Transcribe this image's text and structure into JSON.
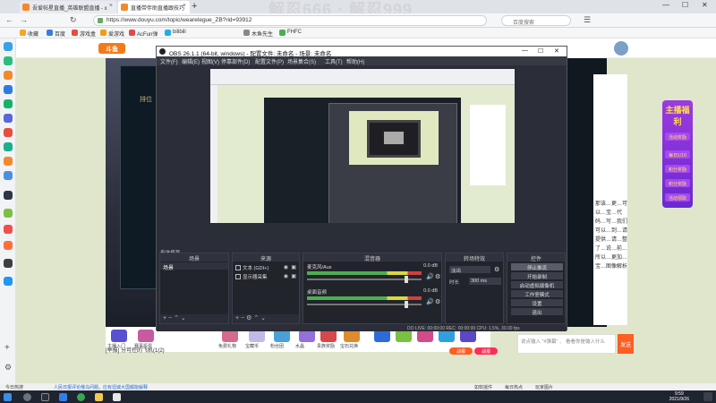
{
  "browser": {
    "tabs": [
      {
        "label": "吾爱帖星直播_英雄联盟直播 - x",
        "active": false
      },
      {
        "label": "直播带伴助直播跟技巧",
        "active": true
      }
    ],
    "watermark": "解忍666 · 解忍999",
    "url": "https://www.douyu.com/topic/wearelegue_ZB?rid=93912",
    "search_placeholder": "百度搜索",
    "bookmarks": [
      "收藏",
      "百度",
      "游戏盒",
      "爱游戏",
      "AcFun弹",
      "bilibili",
      "木鱼先生",
      "FHFC"
    ]
  },
  "page": {
    "logo": "斗鱼",
    "stream_title": "排位",
    "chat_text": "那该…更…可以…宝…代码…写…我们可以…到…请提供…请…整了…说…前…所以…更加…宝…图像解析",
    "promo": {
      "title": "主播福利",
      "rows": [
        "活动奖励",
        "每日1/10",
        "积分奖励",
        "积分奖励",
        "活动领取"
      ]
    },
    "gifts": [
      "主播入门",
      "赛事投票",
      "免费礼物",
      "宝藏币",
      "粉丝团",
      "水晶",
      "贵族奖励",
      "宝石兑换"
    ],
    "report": "[举报] 分可控的飞机(1(2)",
    "chat_input_placeholder": "说点输入 \"#弹幕\" 、 看看你是输入什么",
    "send_label": "发送",
    "bottom_buttons": [
      "战报",
      "战报"
    ]
  },
  "obs": {
    "title": "OBS 26.1.1 (64-bit, windows) - 配置文件: 未命名 - 场景: 未命名",
    "menu": [
      "文件(F)",
      "编辑(E)",
      "视图(V)",
      "停靠部件(D)",
      "配置文件(P)",
      "场景集合(S)",
      "工具(T)",
      "帮助(H)"
    ],
    "docks": {
      "scenes": {
        "title": "场景",
        "items": [
          "场景"
        ]
      },
      "sources": {
        "title": "来源",
        "items": [
          {
            "name": "文本 (GDI+)"
          },
          {
            "name": "显示器采集"
          }
        ]
      },
      "mixer": {
        "title": "混音器",
        "channels": [
          {
            "name": "麦克风/Aux",
            "db": "0.0 dB",
            "level": 0.88
          },
          {
            "name": "桌面音频",
            "db": "0.0 dB",
            "level": 0.88
          }
        ]
      },
      "transitions": {
        "title": "转场特效",
        "type": "淡出",
        "duration_label": "时长",
        "duration": "300 ms"
      },
      "controls": {
        "title": "控件",
        "buttons": [
          "停止推流",
          "开始录制",
          "启动虚拟摄像机",
          "工作室模式",
          "设置",
          "退出"
        ]
      }
    },
    "scene_label": "来选择源",
    "status": "DO LIVE: 00:00:00   REC: 00:00:00   CPU: 1.5%, 30.00 fps"
  },
  "statusbar": {
    "left": "今日热搜",
    "ticker": "人民日报评论俄乌问题，应有坦诚大国都能解释",
    "right_items": [
      "如软摇件",
      "每日热点",
      "玩家图片"
    ]
  },
  "taskbar": {
    "time": "9:59",
    "date": "2021/9/26"
  },
  "colors": {
    "douyu_orange": "#f27a1a",
    "obs_bg": "#2b2e38",
    "page_bg": "#dfe6cc",
    "promo_purple": "#9b3ae0"
  }
}
